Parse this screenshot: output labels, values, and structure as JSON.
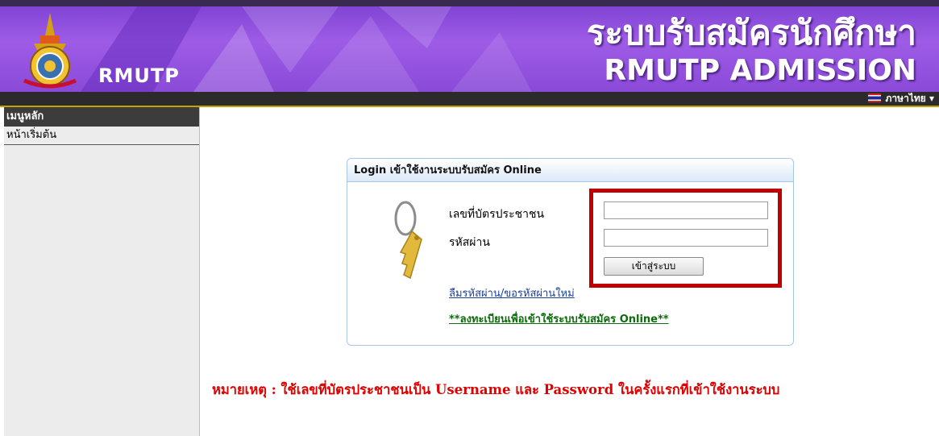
{
  "header": {
    "logo_text": "RMUTP",
    "title_th": "ระบบรับสมัครนักศึกษา",
    "title_en": "RMUTP ADMISSION"
  },
  "toolbar": {
    "language_label": "ภาษาไทย ▾"
  },
  "sidebar": {
    "heading": "เมนูหลัก",
    "items": [
      {
        "label": "หน้าเริ่มต้น"
      }
    ]
  },
  "login": {
    "box_title": "Login เข้าใช้งานระบบรับสมัคร Online",
    "id_label": "เลขที่บัตรประชาชน",
    "id_value": "",
    "password_label": "รหัสผ่าน",
    "password_value": "",
    "submit_label": "เข้าสู่ระบบ",
    "forgot_link": "ลืมรหัสผ่าน/ขอรหัสผ่านใหม่",
    "register_link": "**ลงทะเบียนเพื่อเข้าใช้ระบบรับสมัคร Online**"
  },
  "note": {
    "text": "หมายเหตุ : ใช้เลขที่บัตรประชาชนเป็น Username และ Password ในครั้งแรกที่เข้าใช้งานระบบ"
  },
  "colors": {
    "header_purple": "#8a4ad8",
    "highlight_red": "#c00000",
    "note_red": "#e00000",
    "register_green": "#0d6b0d"
  }
}
